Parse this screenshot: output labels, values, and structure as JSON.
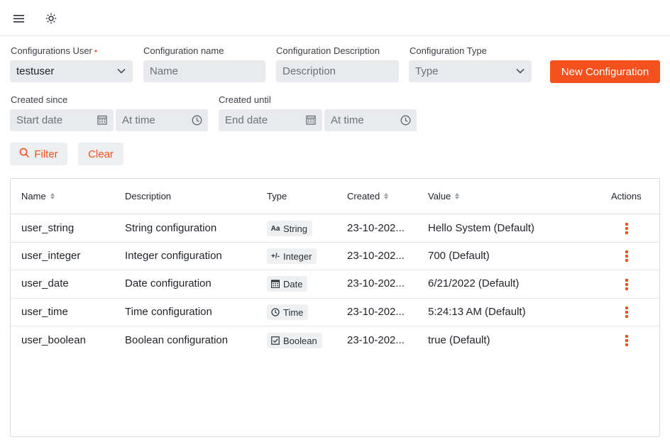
{
  "icons": {
    "menu": "hamburger-menu-icon",
    "theme": "sun-icon"
  },
  "filters": {
    "user": {
      "label": "Configurations User",
      "required_mark": "•",
      "value": "testuser"
    },
    "name": {
      "label": "Configuration name",
      "placeholder": "Name"
    },
    "description": {
      "label": "Configuration Description",
      "placeholder": "Description"
    },
    "type": {
      "label": "Configuration Type",
      "placeholder": "Type"
    },
    "created_since": {
      "label": "Created since",
      "date_placeholder": "Start date",
      "time_placeholder": "At time"
    },
    "created_until": {
      "label": "Created until",
      "date_placeholder": "End date",
      "time_placeholder": "At time"
    },
    "new_button": "New Configuration",
    "filter_button": "Filter",
    "clear_button": "Clear"
  },
  "accent_color": "#f4511e",
  "table": {
    "headers": {
      "name": "Name",
      "description": "Description",
      "type": "Type",
      "created": "Created",
      "value": "Value",
      "actions": "Actions"
    },
    "rows": [
      {
        "name": "user_string",
        "description": "String configuration",
        "type": "String",
        "type_icon": "Aa",
        "created": "23-10-202...",
        "value": "Hello System (Default)"
      },
      {
        "name": "user_integer",
        "description": "Integer configuration",
        "type": "Integer",
        "type_icon": "+/-",
        "created": "23-10-202...",
        "value": "700 (Default)"
      },
      {
        "name": "user_date",
        "description": "Date configuration",
        "type": "Date",
        "type_icon": "calendar",
        "created": "23-10-202...",
        "value": "6/21/2022 (Default)"
      },
      {
        "name": "user_time",
        "description": "Time configuration",
        "type": "Time",
        "type_icon": "clock",
        "created": "23-10-202...",
        "value": "5:24:13 AM (Default)"
      },
      {
        "name": "user_boolean",
        "description": "Boolean configuration",
        "type": "Boolean",
        "type_icon": "checkbox",
        "created": "23-10-202...",
        "value": "true (Default)"
      }
    ]
  }
}
